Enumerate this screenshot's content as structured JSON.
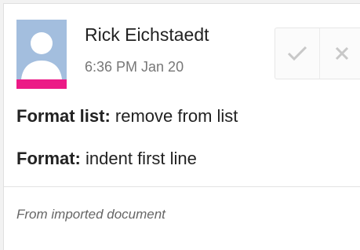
{
  "comment": {
    "author": "Rick Eichstaedt",
    "timestamp": "6:36 PM Jan 20",
    "avatar_icon": "default-user-avatar-icon",
    "avatar_color": "#a3bede",
    "avatar_accent_color": "#ec1a86"
  },
  "actions": {
    "accept_icon": "checkmark-icon",
    "reject_icon": "close-icon"
  },
  "suggestions": [
    {
      "label": "Format list:",
      "value": "remove from list"
    },
    {
      "label": "Format:",
      "value": "indent first line"
    }
  ],
  "footer": {
    "note": "From imported document"
  }
}
